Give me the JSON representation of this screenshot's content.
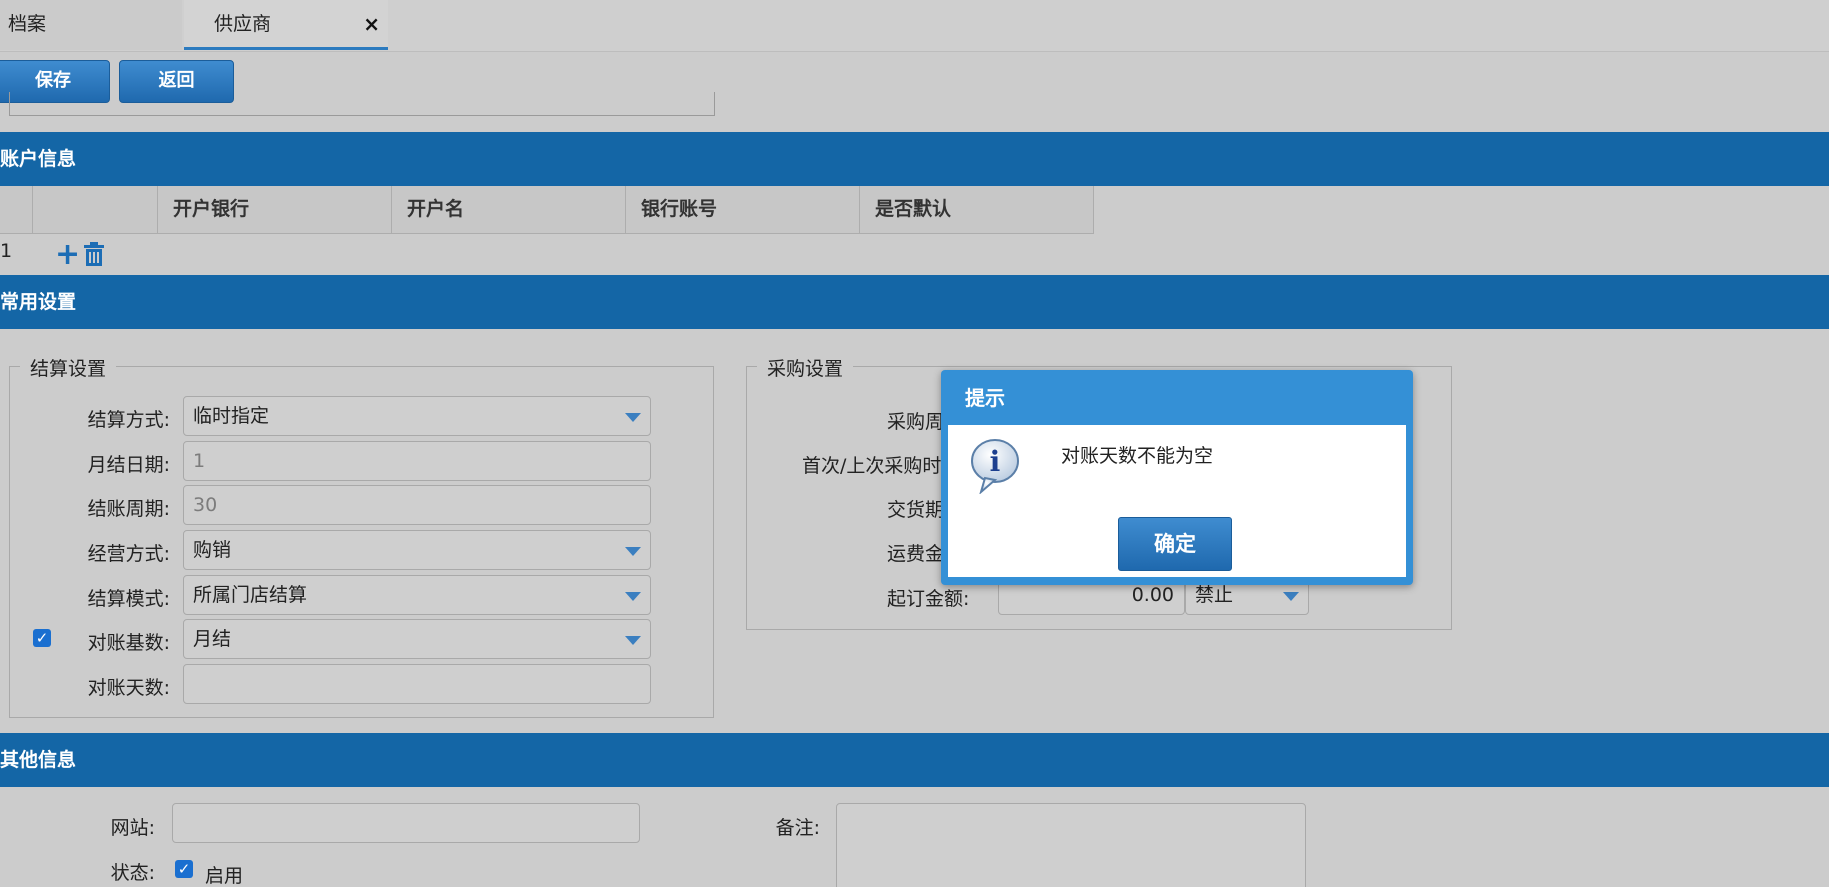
{
  "tabs": [
    {
      "label": "档案"
    },
    {
      "label": "供应商",
      "close": "×"
    }
  ],
  "toolbar": {
    "save_label": "保存",
    "back_label": "返回"
  },
  "sections": {
    "account": "账户信息",
    "common": "常用设置",
    "other": "其他信息"
  },
  "account_grid": {
    "columns": [
      "开户银行",
      "开户名",
      "银行账号",
      "是否默认"
    ],
    "row_number": "1",
    "add_glyph": "+"
  },
  "settle": {
    "legend": "结算设置",
    "method_label": "结算方式:",
    "method_value": "临时指定",
    "month_day_label": "月结日期:",
    "month_day_value": "1",
    "cycle_label": "结账周期:",
    "cycle_value": "30",
    "business_label": "经营方式:",
    "business_value": "购销",
    "mode_label": "结算模式:",
    "mode_value": "所属门店结算",
    "recon_base_label": "对账基数:",
    "recon_base_value": "月结",
    "recon_base_checked": true,
    "recon_days_label": "对账天数:",
    "recon_days_value": ""
  },
  "purchase": {
    "legend": "采购设置",
    "period_label": "采购周",
    "first_last_label": "首次/上次采购时",
    "delivery_label": "交货期",
    "freight_label": "运费金",
    "min_order_label": "起订金额:",
    "min_order_value": "0.00",
    "min_order_option": "禁止"
  },
  "modal": {
    "title": "提示",
    "message": "对账天数不能为空",
    "ok_label": "确定",
    "icon_glyph": "i"
  },
  "other": {
    "website_label": "网站:",
    "website_value": "",
    "remark_label": "备注:",
    "status_label": "状态:",
    "status_checked": true,
    "status_text": "启用"
  },
  "colors": {
    "primary": "#1466a6",
    "button": "#2a77bd",
    "modal_header": "#3490d6",
    "background": "#cccccc"
  },
  "icons": [
    "close-icon",
    "plus-icon",
    "trash-icon",
    "dropdown-caret-icon",
    "checkbox-checked-icon",
    "info-icon"
  ]
}
